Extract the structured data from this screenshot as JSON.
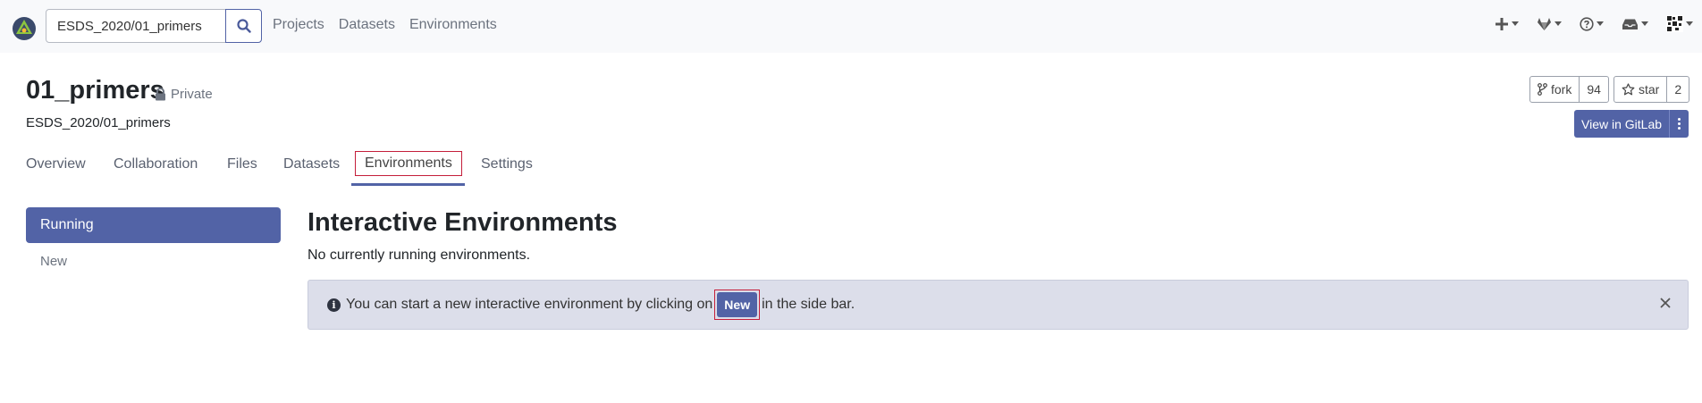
{
  "navbar": {
    "search": {
      "value": "ESDS_2020/01_primers",
      "placeholder": ""
    },
    "links": [
      "Projects",
      "Datasets",
      "Environments"
    ]
  },
  "project": {
    "title": "01_primers",
    "visibility": "Private",
    "path": "ESDS_2020/01_primers",
    "fork_label": "fork",
    "fork_count": "94",
    "star_label": "star",
    "star_count": "2",
    "gitlab_label": "View in GitLab"
  },
  "tabs": [
    "Overview",
    "Collaboration",
    "Files",
    "Datasets",
    "Environments",
    "Settings"
  ],
  "active_tab": "Environments",
  "sidebar": {
    "running_label": "Running",
    "new_label": "New"
  },
  "main": {
    "title": "Interactive Environments",
    "subtitle": "No currently running environments.",
    "alert_prefix": "You can start a new interactive environment by clicking on",
    "alert_button": "New",
    "alert_suffix": "in the side bar."
  },
  "colors": {
    "accent": "#5263a6",
    "navbar_bg": "#f8f9fb",
    "alert_bg": "#dcdeea",
    "highlight_outline": "#c41e3a"
  }
}
